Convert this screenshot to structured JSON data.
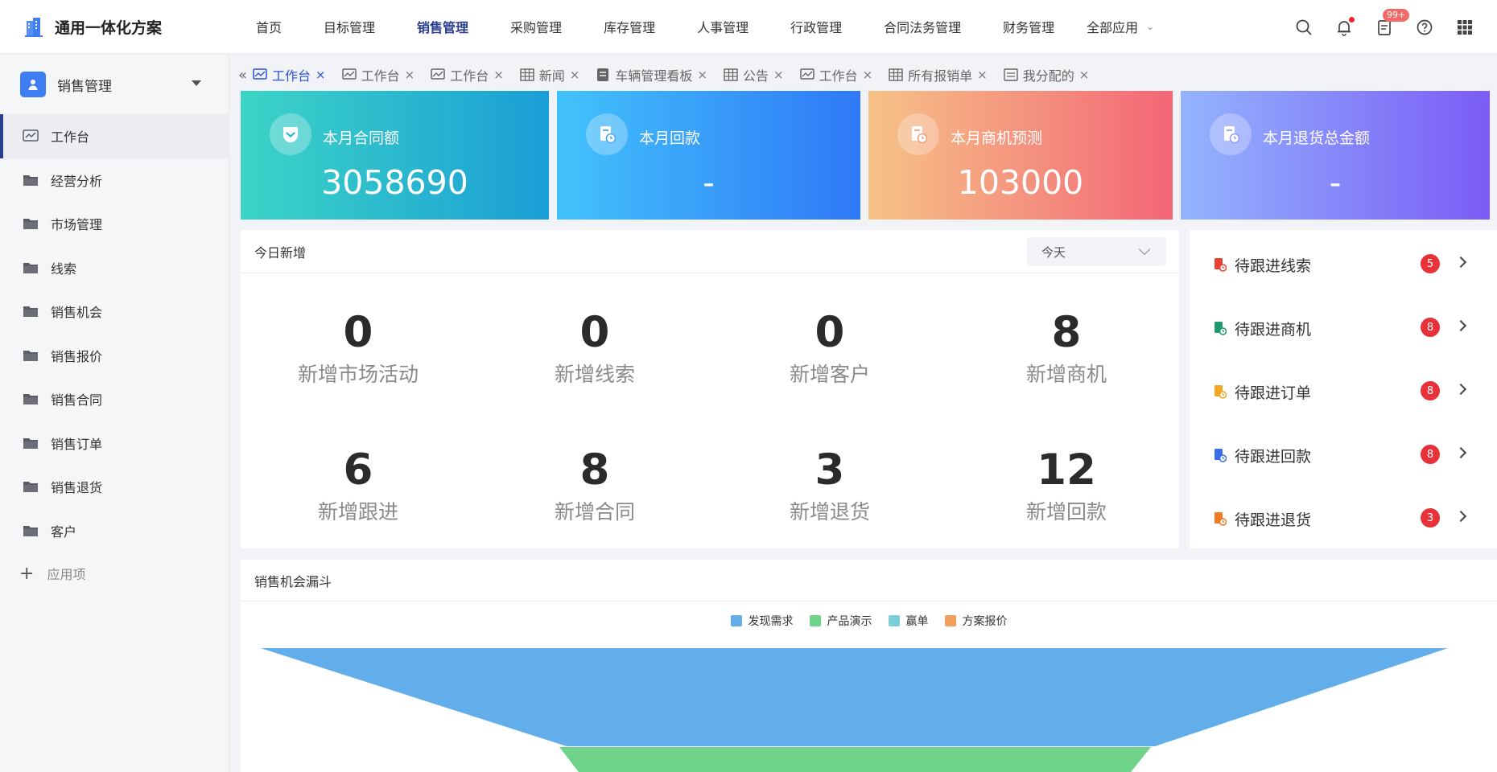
{
  "app": {
    "title": "通用一体化方案"
  },
  "topnav": {
    "items": [
      "首页",
      "目标管理",
      "销售管理",
      "采购管理",
      "库存管理",
      "人事管理",
      "行政管理",
      "合同法务管理",
      "财务管理"
    ],
    "active": "销售管理",
    "all_apps": "全部应用",
    "notification_badge": "99+"
  },
  "sidebar": {
    "module": "销售管理",
    "items": [
      {
        "label": "工作台",
        "icon": "dashboard-icon"
      },
      {
        "label": "经营分析",
        "icon": "folder-icon"
      },
      {
        "label": "市场管理",
        "icon": "folder-icon"
      },
      {
        "label": "线索",
        "icon": "folder-icon"
      },
      {
        "label": "销售机会",
        "icon": "folder-icon"
      },
      {
        "label": "销售报价",
        "icon": "folder-icon"
      },
      {
        "label": "销售合同",
        "icon": "folder-icon"
      },
      {
        "label": "销售订单",
        "icon": "folder-icon"
      },
      {
        "label": "销售退货",
        "icon": "folder-icon"
      },
      {
        "label": "客户",
        "icon": "folder-icon"
      }
    ],
    "add_label": "应用项"
  },
  "tabs": [
    {
      "label": "工作台",
      "icon": "chart-icon",
      "active": true
    },
    {
      "label": "工作台",
      "icon": "chart-icon"
    },
    {
      "label": "工作台",
      "icon": "chart-icon"
    },
    {
      "label": "新闻",
      "icon": "table-icon"
    },
    {
      "label": "车辆管理看板",
      "icon": "doc-icon"
    },
    {
      "label": "公告",
      "icon": "table-icon"
    },
    {
      "label": "工作台",
      "icon": "chart-icon"
    },
    {
      "label": "所有报销单",
      "icon": "table-icon"
    },
    {
      "label": "我分配的",
      "icon": "form-icon"
    }
  ],
  "stat_cards": [
    {
      "label": "本月合同额",
      "value": "3058690"
    },
    {
      "label": "本月回款",
      "value": "-"
    },
    {
      "label": "本月商机预测",
      "value": "103000"
    },
    {
      "label": "本月退货总金额",
      "value": "-"
    }
  ],
  "today_new": {
    "title": "今日新增",
    "period_select": "今天",
    "metrics": [
      {
        "value": "0",
        "label": "新增市场活动"
      },
      {
        "value": "0",
        "label": "新增线索"
      },
      {
        "value": "0",
        "label": "新增客户"
      },
      {
        "value": "8",
        "label": "新增商机"
      },
      {
        "value": "6",
        "label": "新增跟进"
      },
      {
        "value": "8",
        "label": "新增合同"
      },
      {
        "value": "3",
        "label": "新增退货"
      },
      {
        "value": "12",
        "label": "新增回款"
      }
    ]
  },
  "follow_up": [
    {
      "label": "待跟进线索",
      "count": "5",
      "color": "#e8412f"
    },
    {
      "label": "待跟进商机",
      "count": "8",
      "color": "#1f9b6d"
    },
    {
      "label": "待跟进订单",
      "count": "8",
      "color": "#f0a821"
    },
    {
      "label": "待跟进回款",
      "count": "8",
      "color": "#3a6ee8"
    },
    {
      "label": "待跟进退货",
      "count": "3",
      "color": "#f07a22"
    }
  ],
  "funnel": {
    "title": "销售机会漏斗",
    "legend": [
      {
        "name": "发现需求",
        "color": "#62aeea"
      },
      {
        "name": "产品演示",
        "color": "#6fd48a"
      },
      {
        "name": "赢单",
        "color": "#7ccfd6"
      },
      {
        "name": "方案报价",
        "color": "#f0a05a"
      }
    ]
  }
}
